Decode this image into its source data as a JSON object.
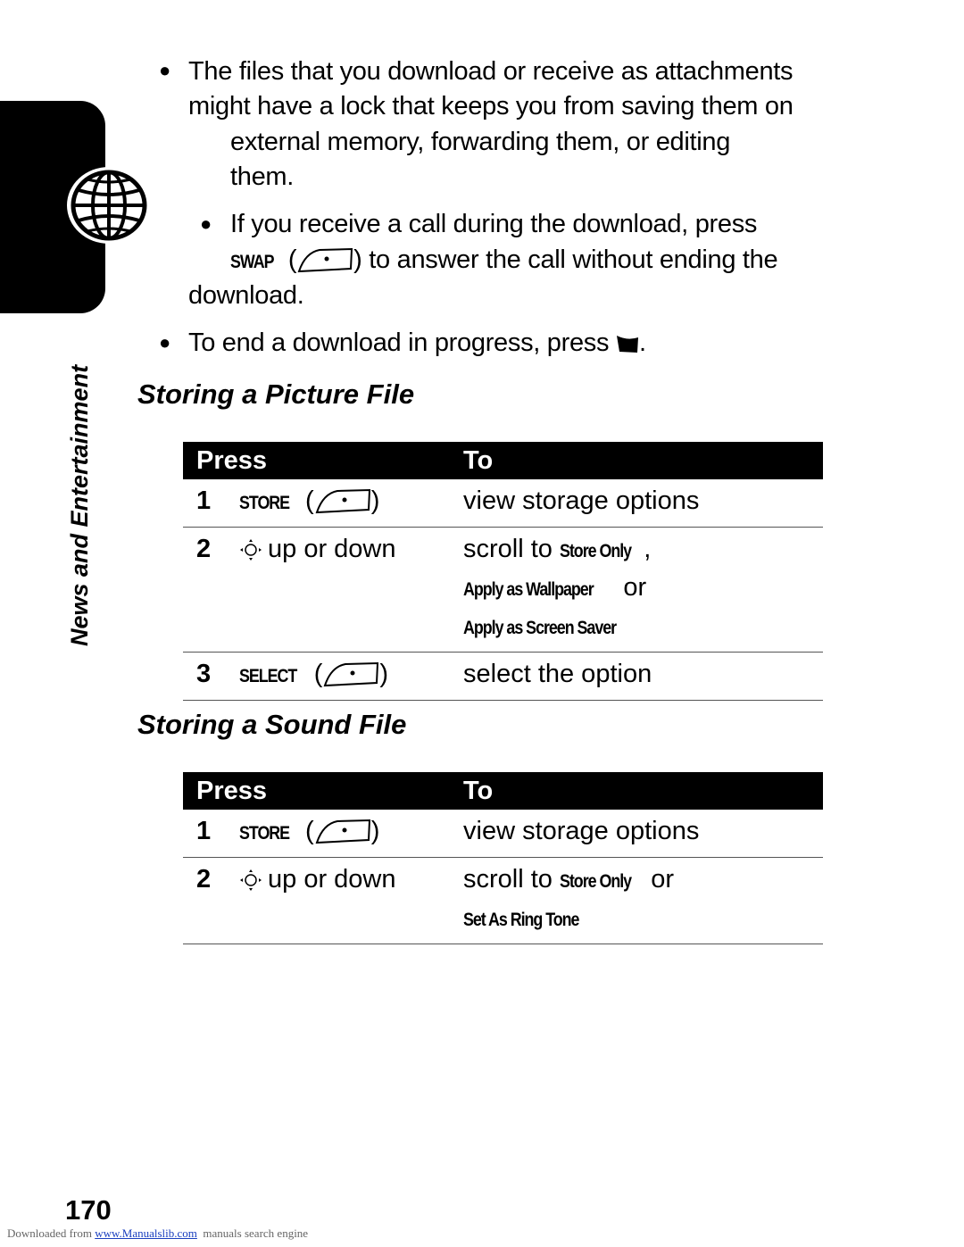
{
  "sidebar": {
    "section_label": "News and Entertainment",
    "icon": "globe-icon"
  },
  "bullets": [
    {
      "lines": [
        "The files that you download or receive as attachments",
        "might have a lock that keeps you from saving them on",
        "external memory, forwarding them, or editing",
        "them."
      ]
    },
    {
      "line1": "If you receive a call during the download, press",
      "key_label": "SWAP",
      "line2_rest": ") to answer the call without ending the",
      "line3": "download."
    },
    {
      "text": "To end a download in progress, press",
      "end_icon": "end-key-icon",
      "suffix": "."
    }
  ],
  "sections": [
    {
      "title": "Storing a Picture File",
      "headers": {
        "press": "Press",
        "to": "To"
      },
      "rows": [
        {
          "num": "1",
          "key": "STORE",
          "key_type": "soft-key-icon",
          "to": "view storage options"
        },
        {
          "num": "2",
          "nav": "nav-key-icon",
          "press": "up or down",
          "to_prefix": "scroll to",
          "options": [
            "Store Only",
            "Apply as Wallpaper",
            "Apply as Screen Saver"
          ],
          "sep1": ",",
          "sep2": "or"
        },
        {
          "num": "3",
          "key": "SELECT",
          "key_type": "soft-key-icon",
          "to": "select the option"
        }
      ]
    },
    {
      "title": "Storing a Sound File",
      "headers": {
        "press": "Press",
        "to": "To"
      },
      "rows": [
        {
          "num": "1",
          "key": "STORE",
          "key_type": "soft-key-icon",
          "to": "view storage options"
        },
        {
          "num": "2",
          "nav": "nav-key-icon",
          "press": "up or down",
          "to_prefix": "scroll to",
          "options": [
            "Store Only",
            "Set As Ring Tone"
          ],
          "sep": "or"
        }
      ]
    }
  ],
  "page_number": "170",
  "footer": {
    "prefix": "Downloaded from",
    "link": "www.Manualslib.com",
    "suffix": "manuals search engine"
  }
}
